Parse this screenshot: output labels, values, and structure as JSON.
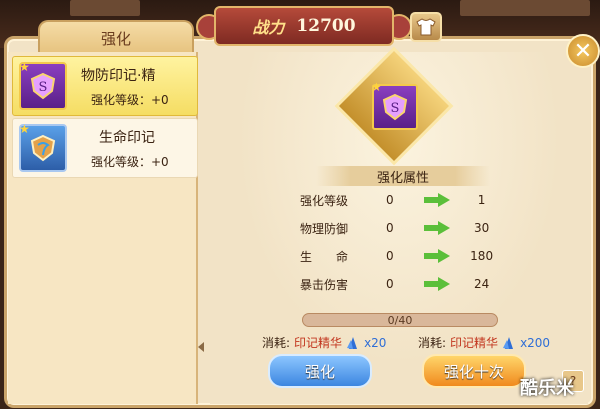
{
  "header": {
    "power_label": "战力",
    "power_value": "12700"
  },
  "tab": {
    "label": "强化"
  },
  "items": [
    {
      "name": "物防印记·精",
      "level": "强化等级：+0",
      "selected": true,
      "icon": "purple-shield-emblem-icon"
    },
    {
      "name": "生命印记",
      "level": "强化等级：+0",
      "selected": false,
      "icon": "blue-shield-emblem-icon"
    }
  ],
  "detail": {
    "section_title": "强化属性",
    "attributes": [
      {
        "name": "强化等级",
        "before": "0",
        "after": "1"
      },
      {
        "name": "物理防御",
        "before": "0",
        "after": "30"
      },
      {
        "name": "生　　命",
        "before": "0",
        "after": "180"
      },
      {
        "name": "暴击伤害",
        "before": "0",
        "after": "24"
      }
    ],
    "progress": {
      "text": "0/40",
      "value": 0,
      "max": 40
    },
    "cost_single": {
      "label": "消耗:",
      "item": "印记精华",
      "qty": "x20"
    },
    "cost_ten": {
      "label": "消耗:",
      "item": "印记精华",
      "qty": "x200"
    },
    "btn_single": "强化",
    "btn_ten": "强化十次"
  },
  "watermark": "酷乐米",
  "colors": {
    "accent_gold": "#e2b56a",
    "cost_item": "#c2361f",
    "cost_qty": "#2f6ed6",
    "arrow_green": "#5bbf3a"
  }
}
